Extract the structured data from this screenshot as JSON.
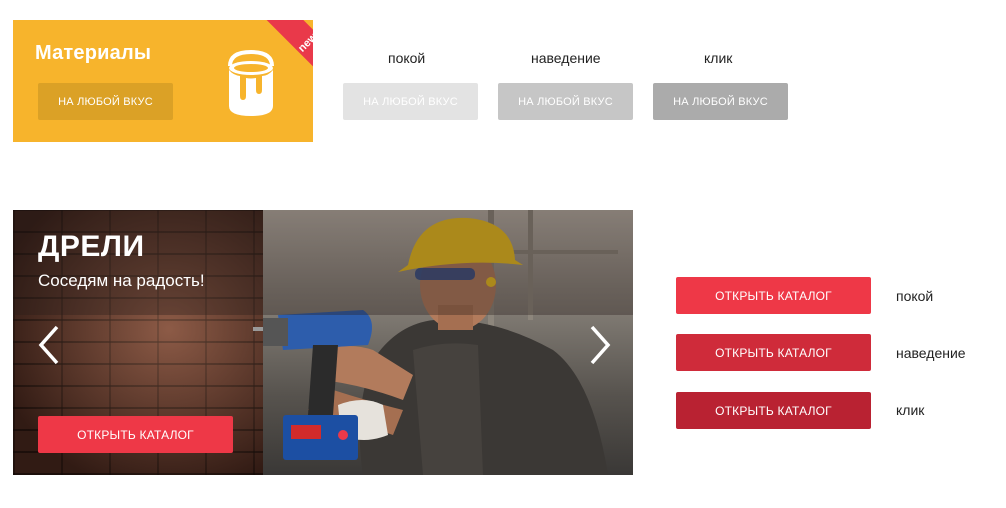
{
  "tile": {
    "title": "Материалы",
    "button_label": "НА ЛЮБОЙ ВКУС",
    "ribbon": "new",
    "icon": "paint-bucket-icon"
  },
  "gray_states": [
    {
      "label": "покой",
      "button_label": "НА ЛЮБОЙ ВКУС",
      "color": "#e3e3e3"
    },
    {
      "label": "наведение",
      "button_label": "НА ЛЮБОЙ ВКУС",
      "color": "#c6c6c6"
    },
    {
      "label": "клик",
      "button_label": "НА ЛЮБОЙ ВКУС",
      "color": "#ababab"
    }
  ],
  "banner": {
    "title": "ДРЕЛИ",
    "subtitle": "Соседям на радость!",
    "button_label": "ОТКРЫТЬ КАТАЛОГ",
    "prev_icon": "chevron-left-icon",
    "next_icon": "chevron-right-icon"
  },
  "red_states": [
    {
      "label": "покой",
      "button_label": "ОТКРЫТЬ КАТАЛОГ",
      "color": "#ee3847"
    },
    {
      "label": "наведение",
      "button_label": "ОТКРЫТЬ КАТАЛОГ",
      "color": "#cf2b3a"
    },
    {
      "label": "клик",
      "button_label": "ОТКРЫТЬ КАТАЛОГ",
      "color": "#b92232"
    }
  ],
  "colors": {
    "tile_bg": "#f7b42c",
    "tile_button": "#dba126",
    "ribbon": "#e9394a",
    "accent_red": "#ee3847"
  }
}
